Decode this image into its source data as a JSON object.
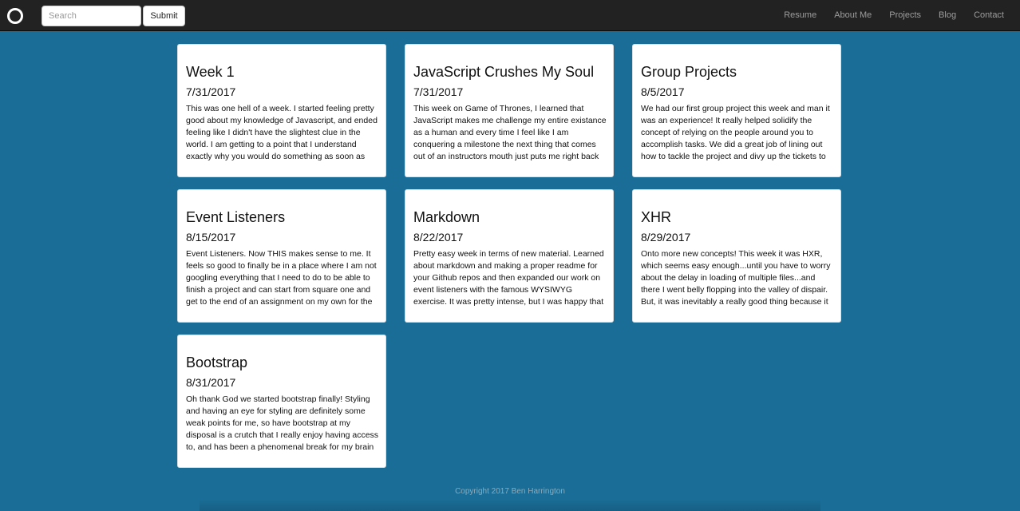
{
  "navbar": {
    "logo_icon": "circle-logo-icon",
    "search": {
      "placeholder": "Search",
      "value": ""
    },
    "submit_label": "Submit",
    "links": [
      "Resume",
      "About Me",
      "Projects",
      "Blog",
      "Contact"
    ]
  },
  "posts": [
    {
      "title": "Week 1",
      "date": "7/31/2017",
      "body": "This was one hell of a week. I started feeling pretty good about my knowledge of Javascript, and ended feeling like I didn't have the slightest clue in the world. I am getting to a point that I understand exactly why you would do something as soon as"
    },
    {
      "title": "JavaScript Crushes My Soul",
      "date": "7/31/2017",
      "body": "This week on Game of Thrones, I learned that JavaScript makes me challenge my entire existance as a human and every time I feel like I am conquering a milestone the next thing that comes out of an instructors mouth just puts me right back"
    },
    {
      "title": "Group Projects",
      "date": "8/5/2017",
      "body": "We had our first group project this week and man it was an experience! It really helped solidify the concept of relying on the people around you to accomplish tasks. We did a great job of lining out how to tackle the project and divy up the tickets to"
    },
    {
      "title": "Event Listeners",
      "date": "8/15/2017",
      "body": "Event Listeners. Now THIS makes sense to me. It feels so good to finally be in a place where I am not googling everything that I need to do to be able to finish a project and can start from square one and get to the end of an assignment on my own for the"
    },
    {
      "title": "Markdown",
      "date": "8/22/2017",
      "body": "Pretty easy week in terms of new material. Learned about markdown and making a proper readme for your Github repos and then expanded our work on event listeners with the famous WYSIWYG exercise. It was pretty intense, but I was happy that I was"
    },
    {
      "title": "XHR",
      "date": "8/29/2017",
      "body": "Onto more new concepts! This week it was HXR, which seems easy enough...until you have to worry about the delay in loading of multiple files...and there I went belly flopping into the valley of dispair. But, it was inevitably a really good thing because it"
    },
    {
      "title": "Bootstrap",
      "date": "8/31/2017",
      "body": "Oh thank God we started bootstrap finally! Styling and having an eye for styling are definitely some weak points for me, so have bootstrap at my disposal is a crutch that I really enjoy having access to, and has been a phenomenal break for my brain"
    }
  ],
  "footer": {
    "copyright": "Copyright 2017 Ben Harrington"
  },
  "colors": {
    "page_background": "#1a6d96",
    "navbar_background": "#222222",
    "nav_link": "#9d9d9d",
    "card_background": "#ffffff"
  }
}
